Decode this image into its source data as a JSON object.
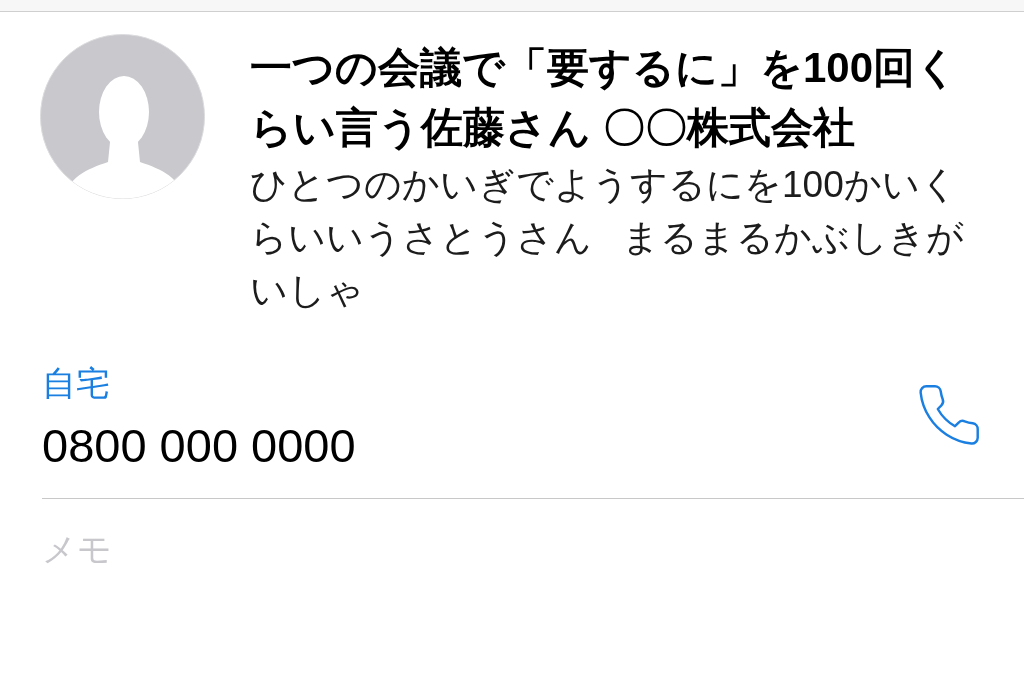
{
  "contact": {
    "name": "一つの会議で「要するに」を100回くらい言う佐藤さん 〇〇株式会社",
    "reading": "ひとつのかいぎでようするにを100かいくらいいうさとうさん まるまるかぶしきがいしゃ"
  },
  "phones": [
    {
      "label": "自宅",
      "number": "0800 000 0000"
    }
  ],
  "notes": {
    "placeholder": "メモ"
  }
}
